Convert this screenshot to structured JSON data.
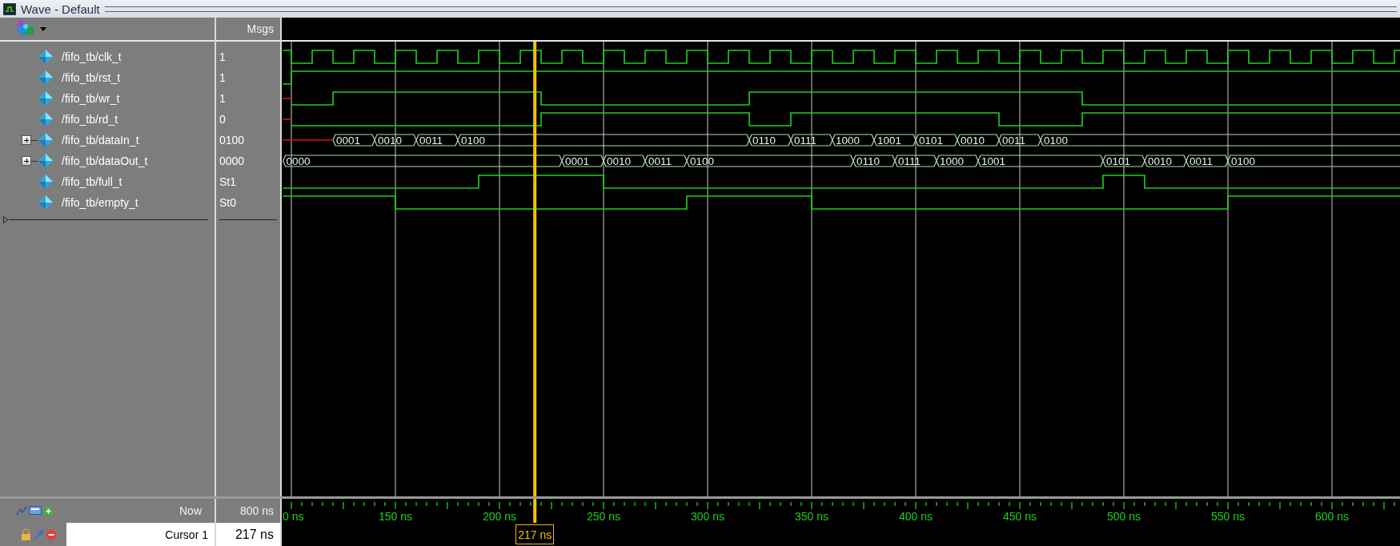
{
  "window": {
    "title": "Wave - Default"
  },
  "header": {
    "values_column": "Msgs"
  },
  "signals": [
    {
      "name": "/fifo_tb/clk_t",
      "value": "1",
      "kind": "bit"
    },
    {
      "name": "/fifo_tb/rst_t",
      "value": "1",
      "kind": "bit"
    },
    {
      "name": "/fifo_tb/wr_t",
      "value": "1",
      "kind": "bit"
    },
    {
      "name": "/fifo_tb/rd_t",
      "value": "0",
      "kind": "bit"
    },
    {
      "name": "/fifo_tb/dataIn_t",
      "value": "0100",
      "kind": "bus",
      "expanded": false,
      "bus_values": [
        "0001",
        "0010",
        "0011",
        "0100",
        "0110",
        "0111",
        "1000",
        "1001",
        "0101",
        "0010",
        "0011",
        "0100"
      ]
    },
    {
      "name": "/fifo_tb/dataOut_t",
      "value": "0000",
      "kind": "bus",
      "expanded": false,
      "bus_values": [
        "0000",
        "0001",
        "0010",
        "0011",
        "0100",
        "0110",
        "0111",
        "1000",
        "1001",
        "0101",
        "0010",
        "0011",
        "0100"
      ]
    },
    {
      "name": "/fifo_tb/full_t",
      "value": "St1",
      "kind": "bit"
    },
    {
      "name": "/fifo_tb/empty_t",
      "value": "St0",
      "kind": "bit"
    }
  ],
  "timeline": {
    "now_label": "Now",
    "now_value": "800 ns",
    "ticks": [
      "0 ns",
      "150 ns",
      "200 ns",
      "250 ns",
      "300 ns",
      "350 ns",
      "400 ns",
      "450 ns",
      "500 ns",
      "550 ns",
      "600 ns"
    ]
  },
  "cursors": [
    {
      "name": "Cursor 1",
      "time": "217 ns",
      "marker": "217 ns"
    }
  ]
}
